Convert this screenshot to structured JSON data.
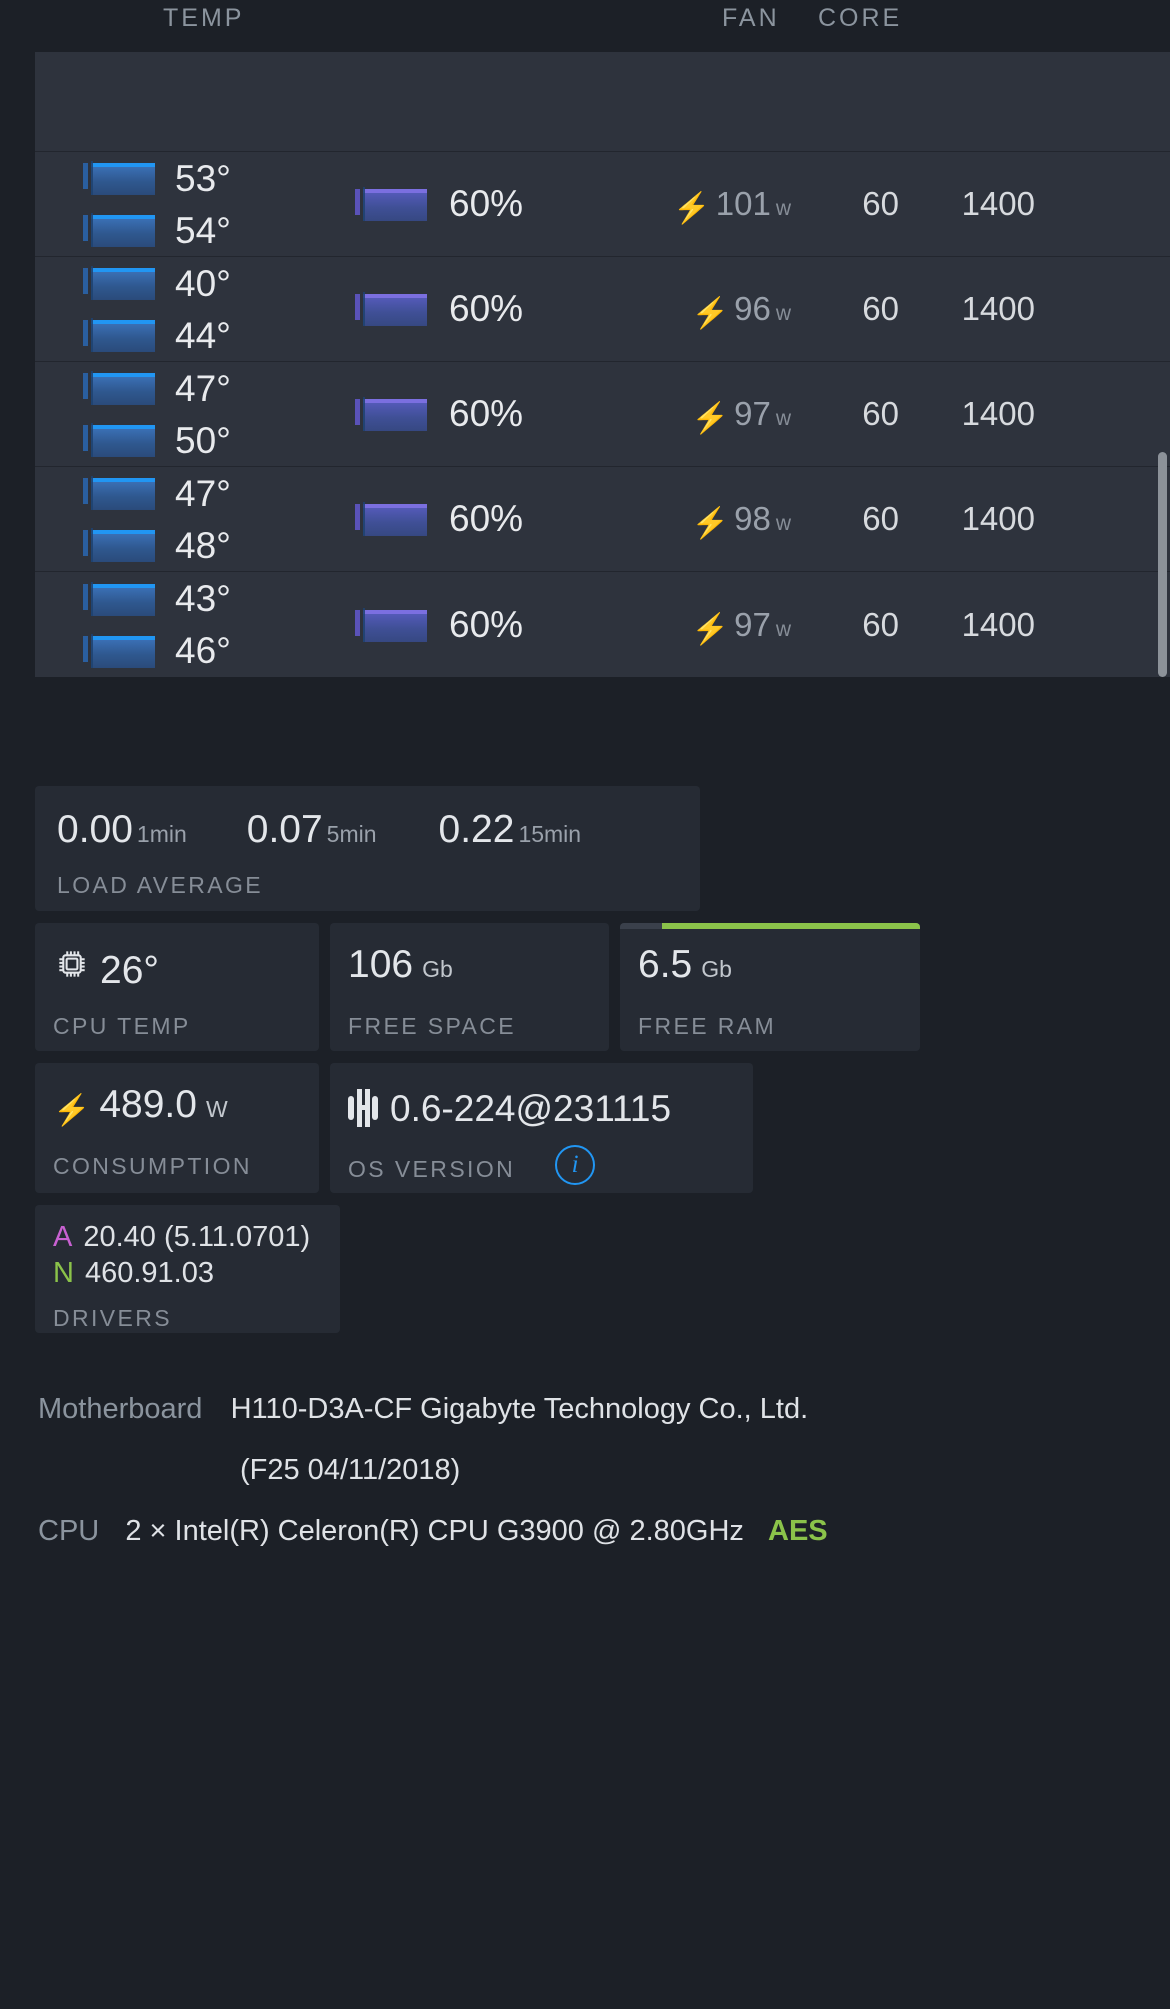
{
  "header": {
    "columns": [
      {
        "key": "temp",
        "label": "TEMP"
      },
      {
        "key": "fan",
        "label": "FAN"
      },
      {
        "key": "core",
        "label": "CORE"
      }
    ],
    "temp_label": "TEMP",
    "fan_label": "FAN",
    "core_label": "CORE"
  },
  "gpu_table": {
    "rows": [
      {
        "temp1": "53°",
        "temp2": "54°",
        "fan_pct": "60%",
        "power": "101",
        "power_unit": "w",
        "fan": "60",
        "core": "1400"
      },
      {
        "temp1": "40°",
        "temp2": "44°",
        "fan_pct": "60%",
        "power": "96",
        "power_unit": "w",
        "fan": "60",
        "core": "1400"
      },
      {
        "temp1": "47°",
        "temp2": "50°",
        "fan_pct": "60%",
        "power": "97",
        "power_unit": "w",
        "fan": "60",
        "core": "1400"
      },
      {
        "temp1": "47°",
        "temp2": "48°",
        "fan_pct": "60%",
        "power": "98",
        "power_unit": "w",
        "fan": "60",
        "core": "1400"
      },
      {
        "temp1": "43°",
        "temp2": "46°",
        "fan_pct": "60%",
        "power": "97",
        "power_unit": "w",
        "fan": "60",
        "core": "1400"
      }
    ]
  },
  "load_average": {
    "label": "LOAD AVERAGE",
    "items": [
      {
        "value": "0.00",
        "unit": "1min"
      },
      {
        "value": "0.07",
        "unit": "5min"
      },
      {
        "value": "0.22",
        "unit": "15min"
      }
    ]
  },
  "stats": {
    "cpu_temp": {
      "value": "26°",
      "unit": "",
      "label": "CPU TEMP"
    },
    "free_space": {
      "value": "106",
      "unit": "Gb",
      "label": "FREE SPACE"
    },
    "free_ram": {
      "value": "6.5",
      "unit": "Gb",
      "label": "FREE RAM",
      "bar_start_pct": 14,
      "bar_color": "#8bc34a"
    },
    "consumption": {
      "value": "489.0",
      "unit": "W",
      "label": "CONSUMPTION"
    },
    "os_version": {
      "value": "0.6-224@231115",
      "label": "OS VERSION",
      "info": "i"
    }
  },
  "drivers": {
    "label": "DRIVERS",
    "amd": {
      "tag": "A",
      "value": "20.40 (5.11.0701)",
      "color": "#c861d1"
    },
    "nvidia": {
      "tag": "N",
      "value": "460.91.03",
      "color": "#8bc34a"
    }
  },
  "hardware": {
    "motherboard_key": "Motherboard",
    "motherboard_value": "H110-D3A-CF Gigabyte Technology Co., Ltd.",
    "motherboard_bios": "(F25 04/11/2018)",
    "cpu_key": "CPU",
    "cpu_value": "2 × Intel(R) Celeron(R) CPU G3900 @ 2.80GHz",
    "cpu_flag": "AES"
  },
  "colors": {
    "background": "#1c2027",
    "panel": "#262b34",
    "row": "#2e333d",
    "accent_blue": "#2196f3",
    "accent_green": "#8bc34a",
    "accent_purple": "#7b6fe0",
    "accent_magenta": "#c861d1"
  }
}
